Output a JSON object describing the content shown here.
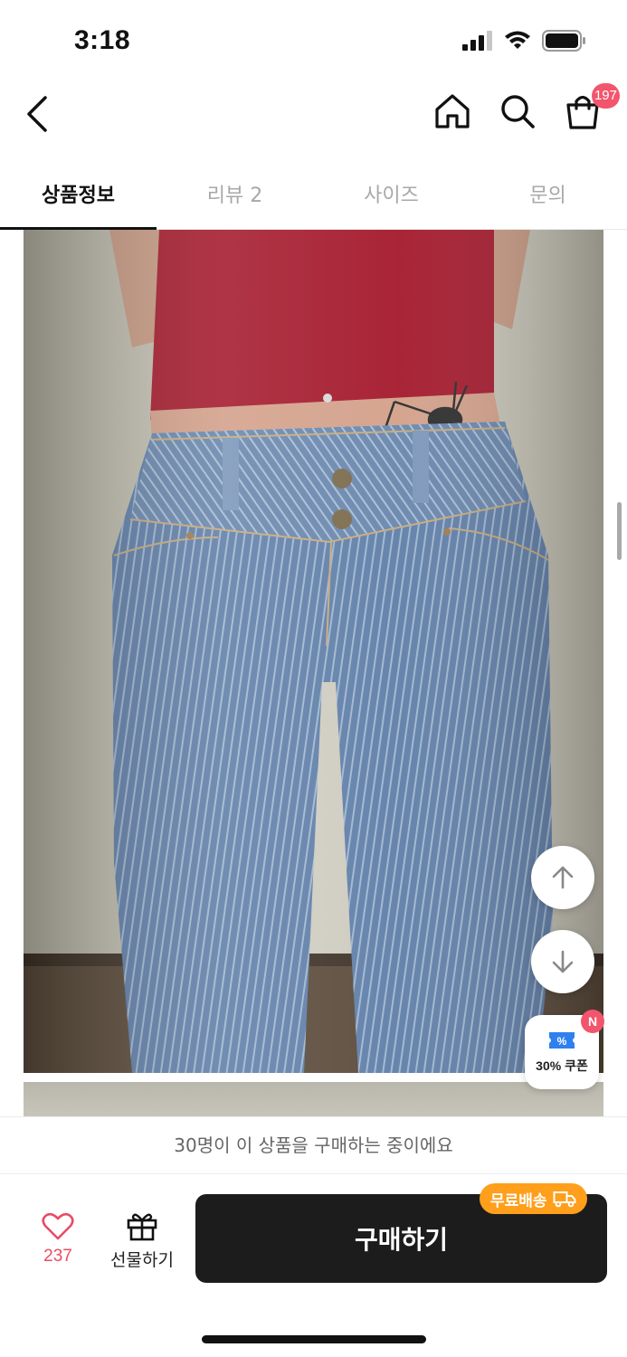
{
  "status_bar": {
    "time": "3:18"
  },
  "nav": {
    "cart_count": "197"
  },
  "tabs": [
    {
      "label": "상품정보",
      "active": true
    },
    {
      "label": "리뷰 2",
      "active": false
    },
    {
      "label": "사이즈",
      "active": false
    },
    {
      "label": "문의",
      "active": false
    }
  ],
  "floating": {
    "coupon_label": "30% 쿠폰",
    "coupon_new_badge": "N"
  },
  "bottom": {
    "buying_banner": "30명이 이 상품을 구매하는 중이에요",
    "like_count": "237",
    "gift_label": "선물하기",
    "buy_label": "구매하기",
    "free_shipping_label": "무료배송"
  },
  "colors": {
    "accent_pink": "#f2556c",
    "buy_button": "#1c1c1c",
    "free_shipping": "#ff9f1c"
  },
  "icons": [
    "back-icon",
    "home-icon",
    "search-icon",
    "cart-icon",
    "arrow-up-icon",
    "arrow-down-icon",
    "coupon-icon",
    "heart-icon",
    "gift-icon",
    "truck-icon"
  ]
}
